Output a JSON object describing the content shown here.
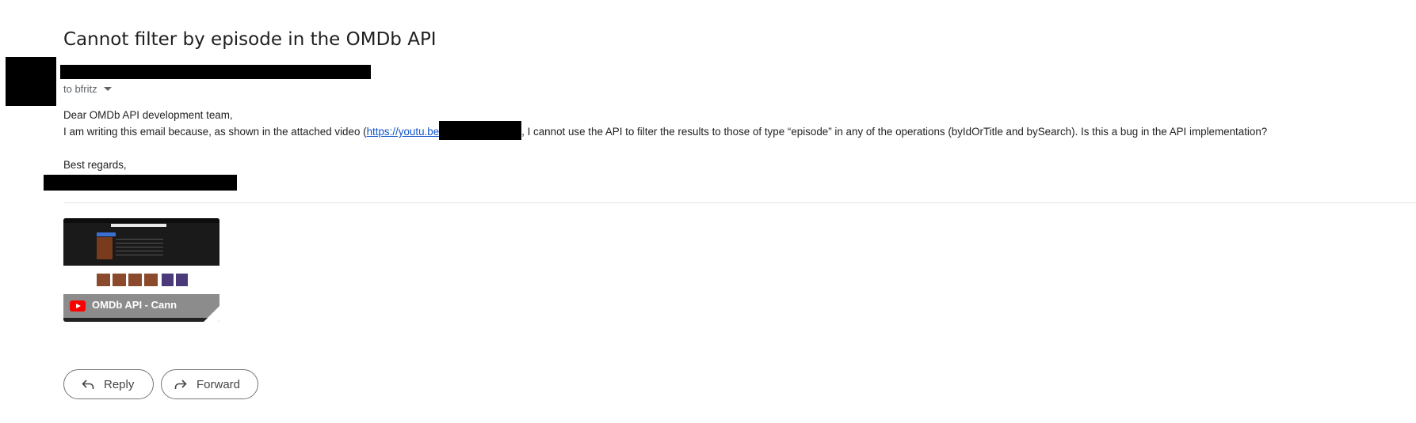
{
  "email": {
    "subject": "Cannot filter by episode in the OMDb API",
    "recipient": "to bfritz",
    "body": {
      "greeting": "Dear OMDb API development team,",
      "line_before_link": "I am writing this email because, as shown in the attached video (",
      "link_text": "https://youtu.be",
      "line_after_link": ", I cannot use the API to filter the results to those of type “episode” in any of the operations (byIdOrTitle and bySearch). Is this a bug in the API implementation?",
      "closing": "Best regards,"
    }
  },
  "attachment": {
    "video_title": "OMDb API - Cann",
    "icon": "youtube-icon"
  },
  "actions": {
    "reply_label": "Reply",
    "forward_label": "Forward"
  }
}
